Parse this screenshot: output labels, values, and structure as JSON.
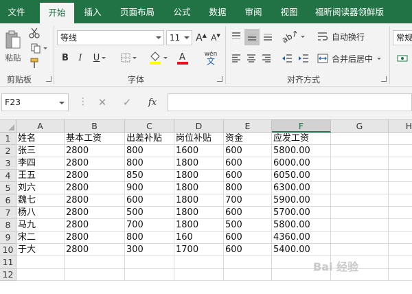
{
  "ribbon_tabs": [
    {
      "label": "文件",
      "active": false
    },
    {
      "label": "开始",
      "active": true
    },
    {
      "label": "插入",
      "active": false
    },
    {
      "label": "页面布局",
      "active": false
    },
    {
      "label": "公式",
      "active": false
    },
    {
      "label": "数据",
      "active": false
    },
    {
      "label": "审阅",
      "active": false
    },
    {
      "label": "视图",
      "active": false
    },
    {
      "label": "福昕阅读器领鲜版",
      "active": false
    }
  ],
  "clipboard": {
    "paste_label": "粘贴",
    "group_label": "剪贴板"
  },
  "font": {
    "name": "等线",
    "size": "11",
    "bold": "B",
    "italic": "I",
    "underline": "U",
    "group_label": "字体",
    "phonetic": "wén"
  },
  "alignment": {
    "wrap_label": "自动换行",
    "merge_label": "合并后居中",
    "group_label": "对齐方式"
  },
  "number": {
    "format_label": "常规"
  },
  "formula_bar": {
    "name_box": "F23",
    "fx": "fx",
    "value": ""
  },
  "grid": {
    "columns": [
      "A",
      "B",
      "C",
      "D",
      "E",
      "F",
      "G",
      "H"
    ],
    "selected_column": "F",
    "rows": [
      "1",
      "2",
      "3",
      "4",
      "5",
      "6",
      "7",
      "8",
      "9",
      "10",
      "11",
      "12"
    ],
    "cells": [
      [
        "姓名",
        "基本工资",
        "出差补贴",
        "岗位补贴",
        "资金",
        "应发工资"
      ],
      [
        "张三",
        "2800",
        "800",
        "1600",
        "600",
        "5800.00"
      ],
      [
        "李四",
        "2800",
        "800",
        "1800",
        "600",
        "6000.00"
      ],
      [
        "王五",
        "2800",
        "850",
        "1800",
        "600",
        "6050.00"
      ],
      [
        "刘六",
        "2800",
        "900",
        "1800",
        "800",
        "6300.00"
      ],
      [
        "魏七",
        "2800",
        "600",
        "1800",
        "700",
        "5900.00"
      ],
      [
        "杨八",
        "2800",
        "500",
        "1800",
        "600",
        "5700.00"
      ],
      [
        "马九",
        "2800",
        "700",
        "1800",
        "500",
        "5800.00"
      ],
      [
        "宋二",
        "2800",
        "800",
        "160",
        "600",
        "4360.00"
      ],
      [
        "于大",
        "2800",
        "300",
        "1700",
        "600",
        "5400.00"
      ],
      [
        "",
        "",
        "",
        "",
        "",
        ""
      ],
      [
        "",
        "",
        "",
        "",
        "",
        ""
      ]
    ]
  },
  "watermark": "Bai 经验",
  "colors": {
    "accent": "#217346",
    "ribbon_bg": "#f3f3f3"
  }
}
